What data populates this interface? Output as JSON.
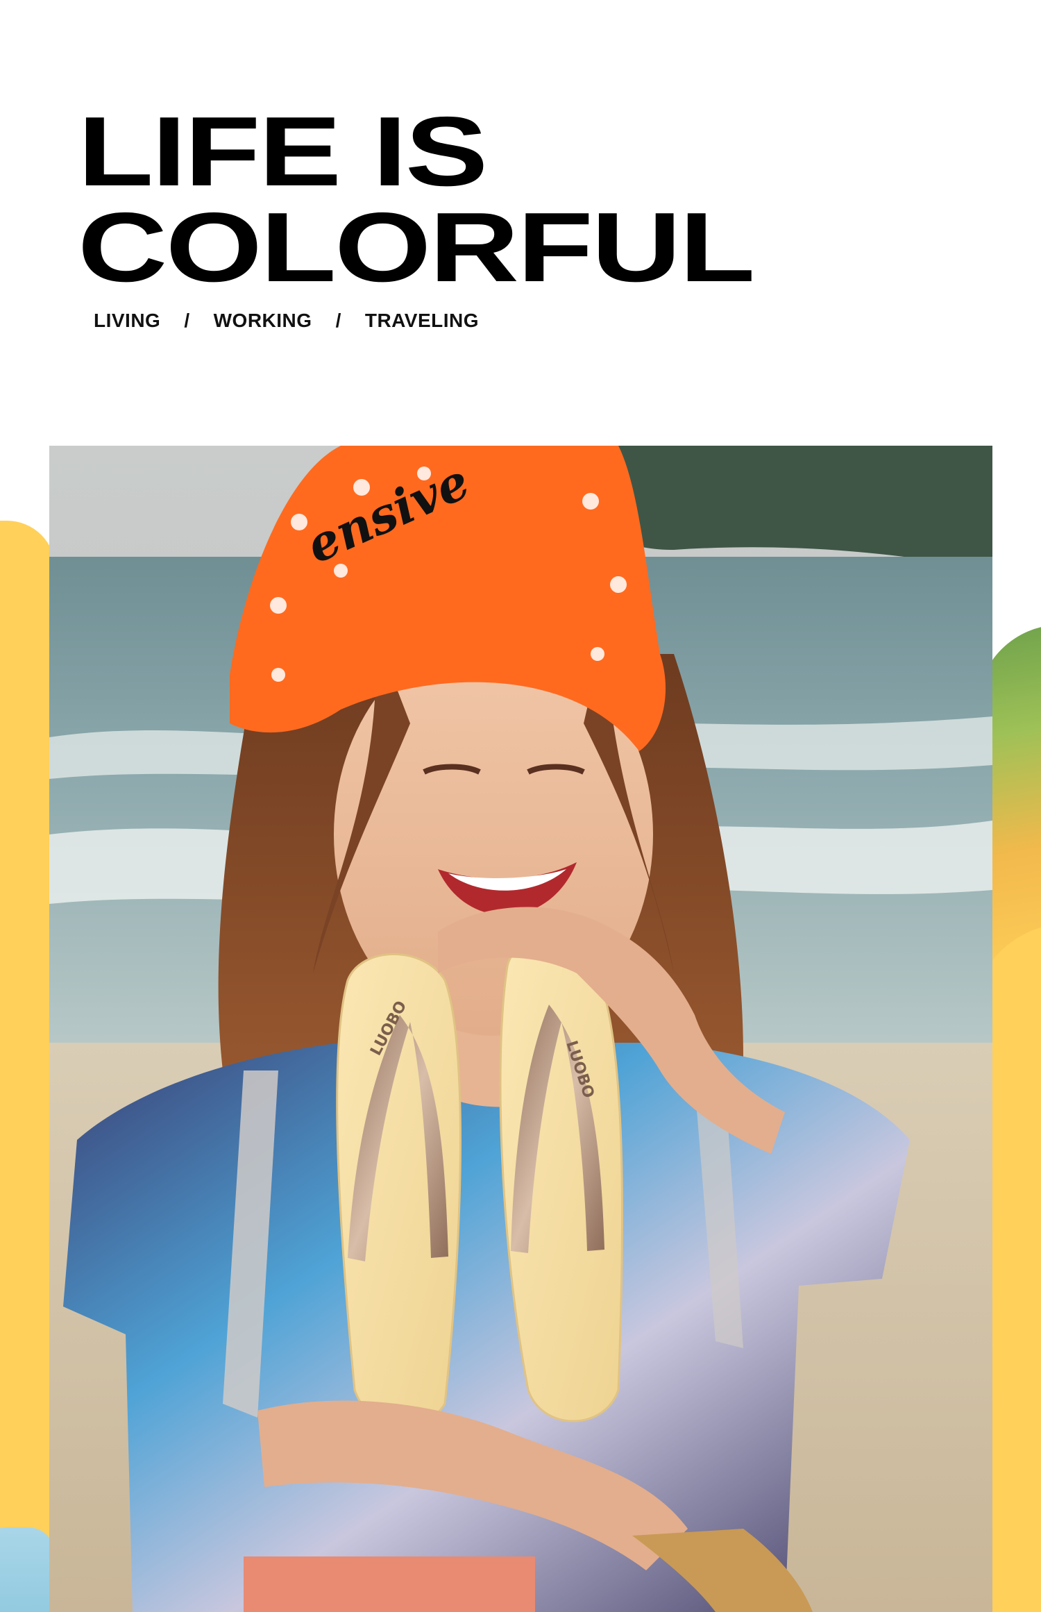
{
  "headline": {
    "line1": "LIFE IS",
    "line2": "COLORFUL"
  },
  "subnav": {
    "items": [
      "LIVING",
      "WORKING",
      "TRAVELING"
    ],
    "separator": "/"
  },
  "photo": {
    "hat_text": "ensive",
    "sandal_brand": "LUOBO"
  },
  "colors": {
    "text": "#000000",
    "accent_yellow": "#ffd05a",
    "accent_green": "#7fb04f",
    "hat_orange": "#ff6a1f",
    "sandal_cream": "#f7dfa4",
    "strap_bronze": "#b9987f"
  }
}
